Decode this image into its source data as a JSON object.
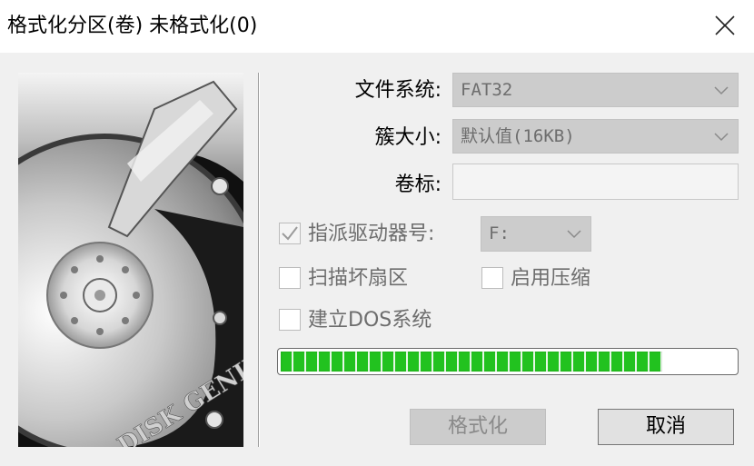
{
  "window": {
    "title": "格式化分区(卷) 未格式化(0)",
    "close_icon": "close-icon"
  },
  "image": {
    "brand_text": "DISK GENIUS"
  },
  "form": {
    "filesystem_label": "文件系统:",
    "filesystem_value": "FAT32",
    "cluster_label": "簇大小:",
    "cluster_value": "默认值(16KB)",
    "volume_label": "卷标:",
    "volume_value": "",
    "assign_drive_label": "指派驱动器号:",
    "assign_drive_checked": true,
    "drive_letter_value": "F:",
    "scan_bad_label": "扫描坏扇区",
    "scan_bad_checked": false,
    "compression_label": "启用压缩",
    "compression_checked": false,
    "dos_system_label": "建立DOS系统",
    "dos_system_checked": false
  },
  "progress": {
    "percent": 84,
    "color": "#22c21f"
  },
  "buttons": {
    "format_label": "格式化",
    "cancel_label": "取消"
  }
}
